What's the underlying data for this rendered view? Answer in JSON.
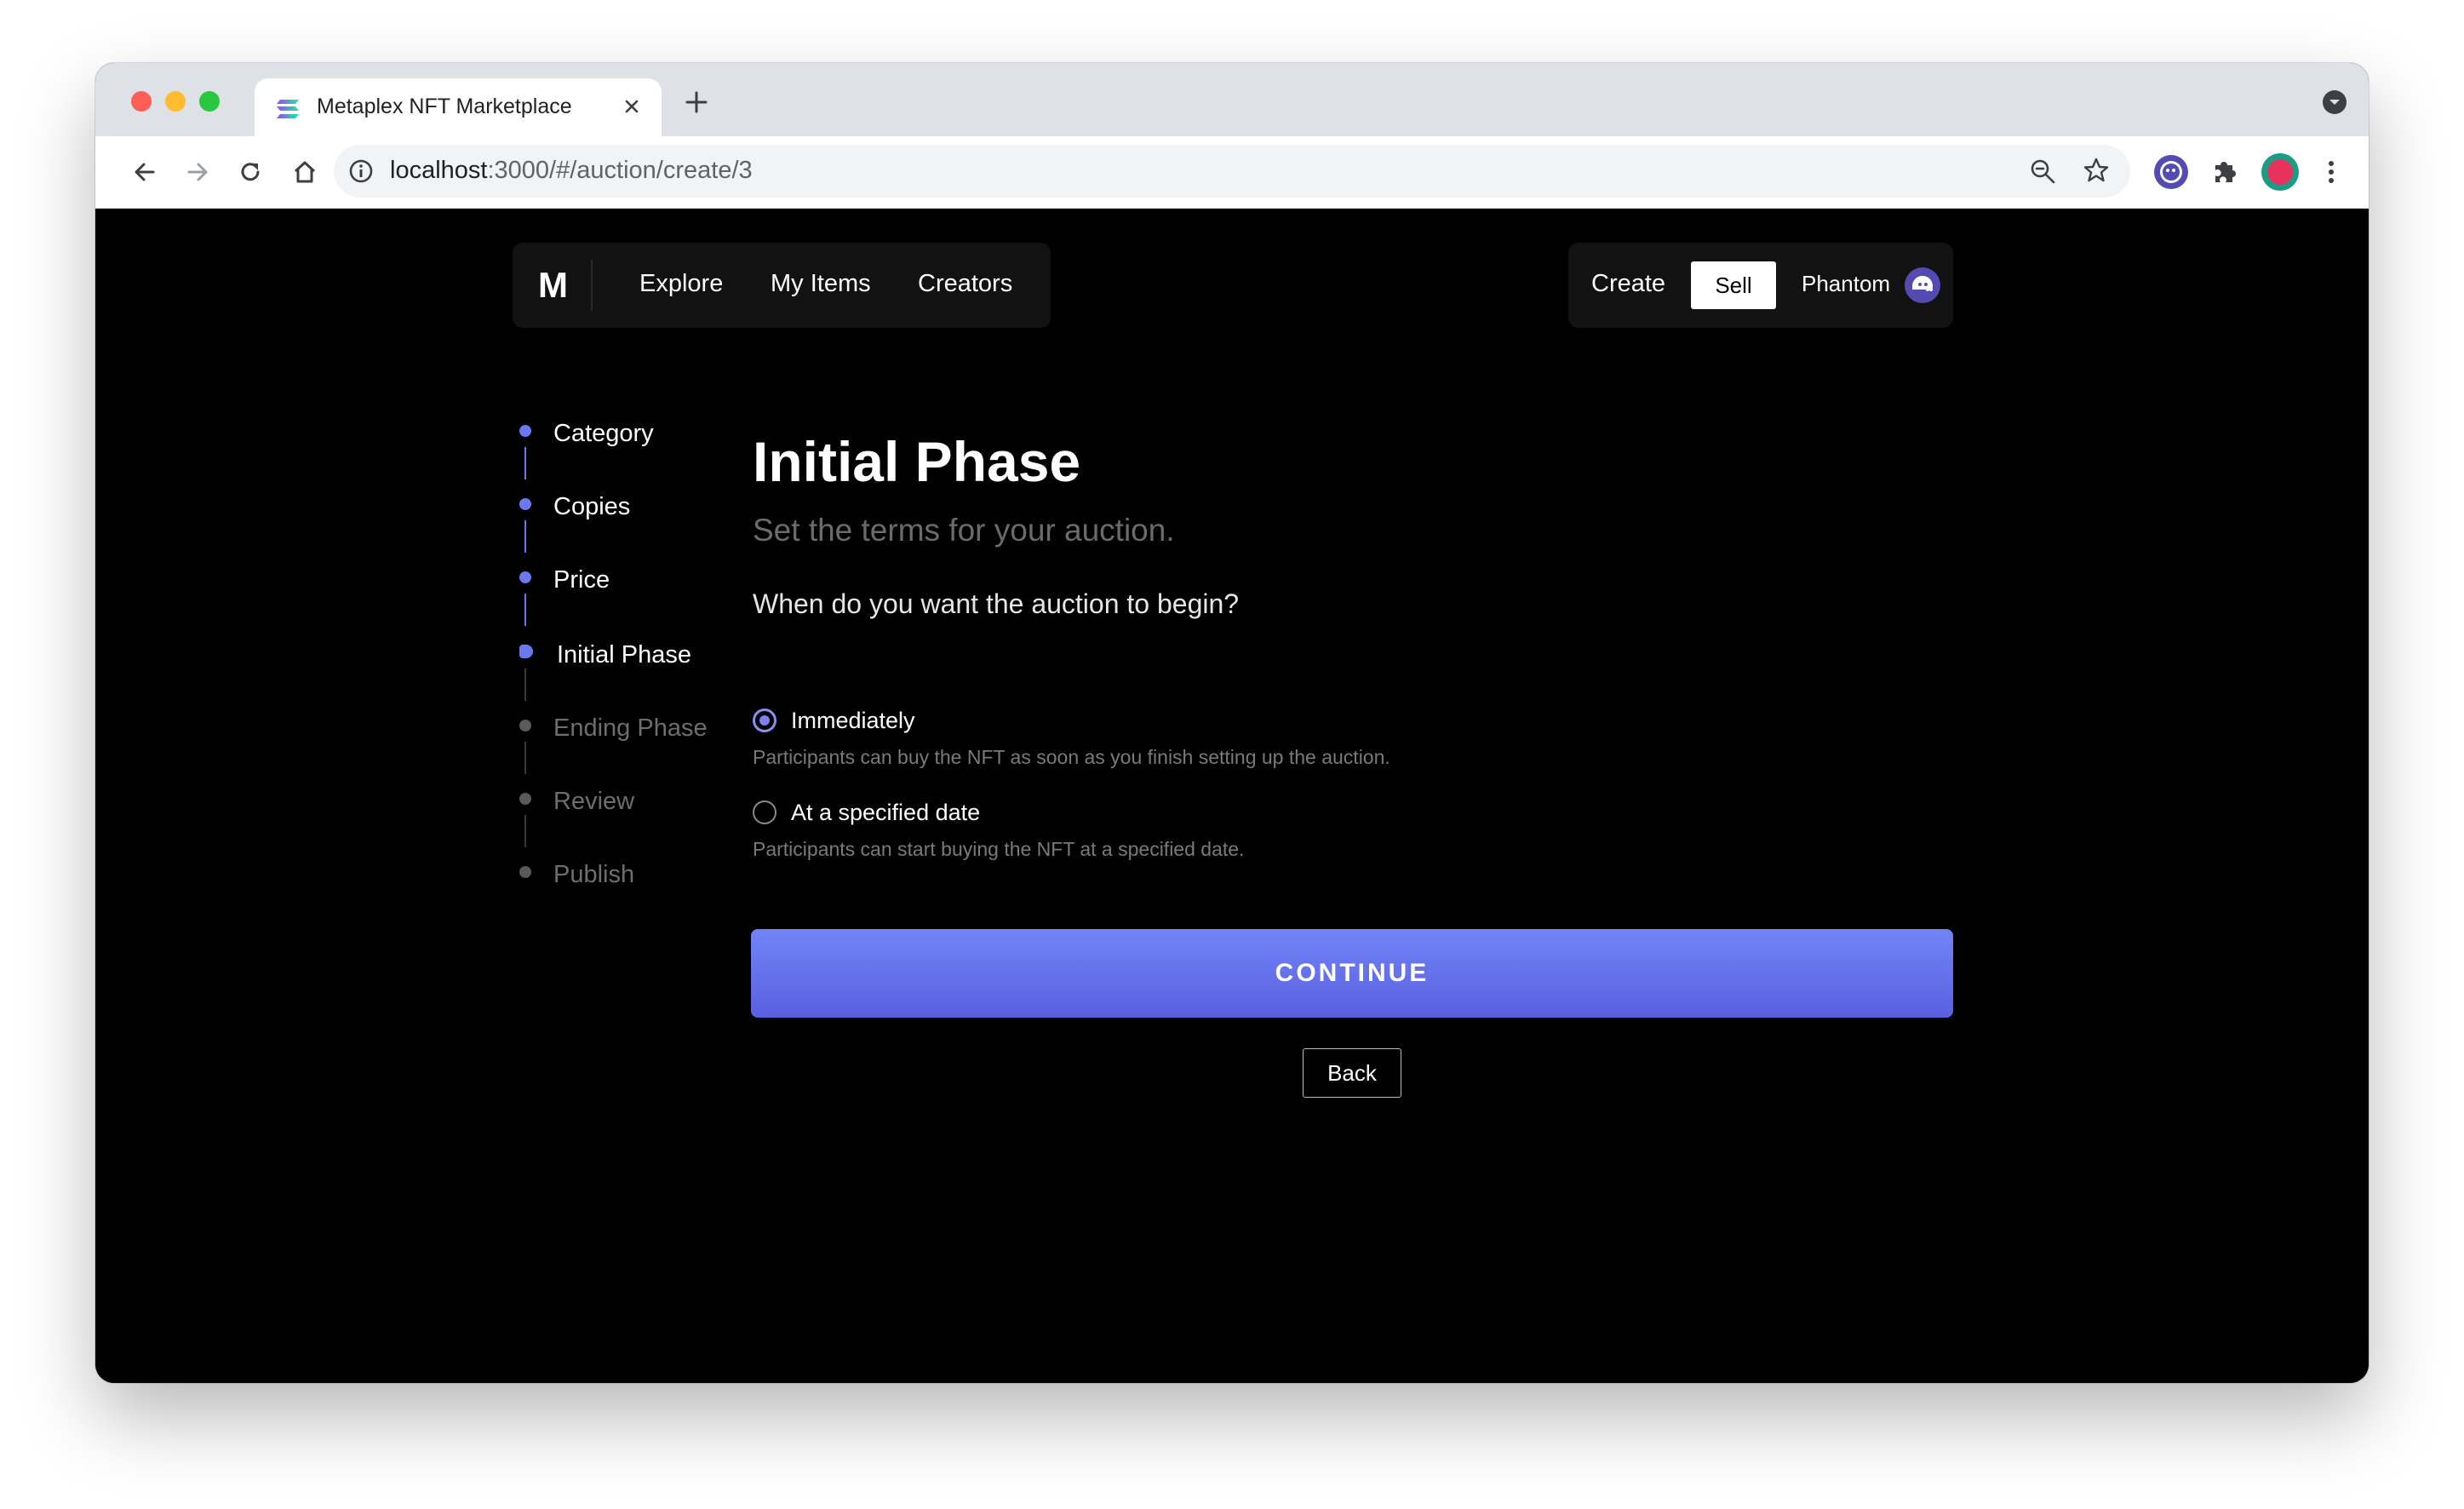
{
  "browser": {
    "tab_title": "Metaplex NFT Marketplace",
    "url_host": "localhost",
    "url_path": ":3000/#/auction/create/3",
    "icons": [
      "back-icon",
      "forward-icon",
      "reload-icon",
      "home-icon",
      "info-icon",
      "zoom-icon",
      "star-icon",
      "phantom-extension-icon",
      "puzzle-icon",
      "profile-avatar",
      "menu-icon"
    ]
  },
  "nav": {
    "logo": "M",
    "links": [
      "Explore",
      "My Items",
      "Creators"
    ],
    "create_label": "Create",
    "sell_label": "Sell",
    "wallet_label": "Phantom"
  },
  "steps": [
    {
      "label": "Category",
      "state": "done"
    },
    {
      "label": "Copies",
      "state": "done"
    },
    {
      "label": "Price",
      "state": "done"
    },
    {
      "label": "Initial Phase",
      "state": "current"
    },
    {
      "label": "Ending Phase",
      "state": "pending"
    },
    {
      "label": "Review",
      "state": "pending"
    },
    {
      "label": "Publish",
      "state": "pending"
    }
  ],
  "form": {
    "title": "Initial Phase",
    "subtitle": "Set the terms for your auction.",
    "question": "When do you want the auction to begin?",
    "options": [
      {
        "label": "Immediately",
        "description": "Participants can buy the NFT as soon as you finish setting up the auction.",
        "selected": true
      },
      {
        "label": "At a specified date",
        "description": "Participants can start buying the NFT at a specified date.",
        "selected": false
      }
    ],
    "continue_label": "CONTINUE",
    "back_label": "Back"
  },
  "colors": {
    "accent": "#6b78f2",
    "background": "#000000",
    "panel": "#121212",
    "muted_text": "#6b6b6b"
  }
}
